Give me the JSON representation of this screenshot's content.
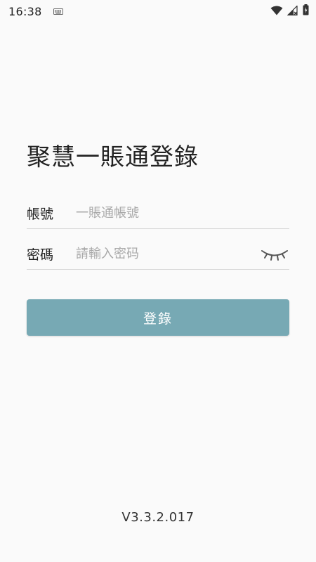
{
  "status_bar": {
    "time": "16:38",
    "icons": [
      "keyboard-icon",
      "wifi-icon",
      "cell-signal-icon",
      "battery-icon"
    ]
  },
  "login": {
    "title": "聚慧一賬通登錄",
    "account": {
      "label": "帳號",
      "value": "",
      "placeholder": "一賬通帳號"
    },
    "password": {
      "label": "密碼",
      "value": "",
      "placeholder": "請輸入密码",
      "toggle_icon": "eye-closed-icon"
    },
    "submit_label": "登錄"
  },
  "footer": {
    "version": "V3.3.2.017"
  },
  "colors": {
    "background": "#fafafa",
    "button": "#77a9b4",
    "button_text": "#ffffff",
    "divider": "#d8d8d8",
    "placeholder": "#a8a8a8"
  }
}
